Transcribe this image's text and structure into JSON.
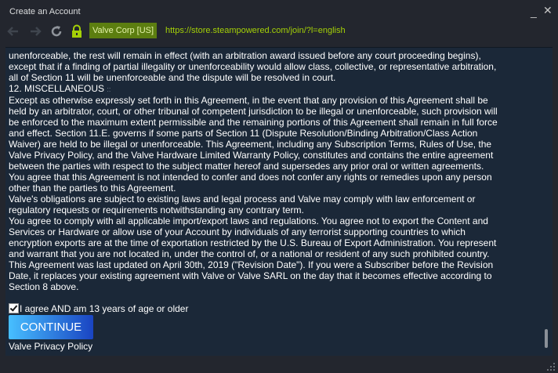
{
  "window": {
    "title": "Create an Account",
    "minimize_glyph": "_",
    "close_glyph": "✕"
  },
  "nav": {
    "back_icon": "back-arrow-icon",
    "forward_icon": "forward-arrow-icon",
    "reload_icon": "reload-icon",
    "lock_icon": "lock-icon",
    "cert_label": "Valve Corp [US]",
    "url": "https://store.steampowered.com/join/?l=english"
  },
  "agreement": {
    "paragraphs": [
      "unenforceable, the rest will remain in effect (with an arbitration award issued before any court proceeding begins), except that if a finding of partial illegality or unenforceability would allow class, collective, or representative arbitration, all of Section 11 will be unenforceable and the dispute will be resolved in court.",
      "Except as otherwise expressly set forth in this Agreement, in the event that any provision of this Agreement shall be held by an arbitrator, court, or other tribunal of competent jurisdiction to be illegal or unenforceable, such provision will be enforced to the maximum extent permissible and the remaining portions of this Agreement shall remain in full force and effect. Section 11.E. governs if some parts of Section 11 (Dispute Resolution/Binding Arbitration/Class Action Waiver) are held to be illegal or unenforceable. This Agreement, including any Subscription Terms, Rules of Use, the Valve Privacy Policy, and the Valve Hardware Limited Warranty Policy, constitutes and contains the entire agreement between the parties with respect to the subject matter hereof and supersedes any prior oral or written agreements. You agree that this Agreement is not intended to confer and does not confer any rights or remedies upon any person other than the parties to this Agreement.",
      "Valve's obligations are subject to existing laws and legal process and Valve may comply with law enforcement or regulatory requests or requirements notwithstanding any contrary term.",
      "You agree to comply with all applicable import/export laws and regulations. You agree not to export the Content and Services or Hardware or allow use of your Account by individuals of any terrorist supporting countries to which encryption exports are at the time of exportation restricted by the U.S. Bureau of Export Administration. You represent and warrant that you are not located in, under the control of, or a national or resident of any such prohibited country.",
      "This Agreement was last updated on April 30th, 2019 (\"Revision Date\"). If you were a Subscriber before the Revision Date, it replaces your existing agreement with Valve or Valve SARL on the day that it becomes effective according to Section 8 above."
    ],
    "section_heading": "12. MISCELLANEOUS",
    "section_mark": "::"
  },
  "form": {
    "agree_checked": true,
    "agree_label": "I agree AND am 13 years of age or older",
    "continue_label": "CONTINUE",
    "privacy_link": "Valve Privacy Policy"
  },
  "colors": {
    "accent_green": "#a4d007",
    "cert_bg": "#5c7e10",
    "content_bg": "#1b2838",
    "button_gradient_start": "#47bfff",
    "button_gradient_end": "#1a44c2"
  }
}
